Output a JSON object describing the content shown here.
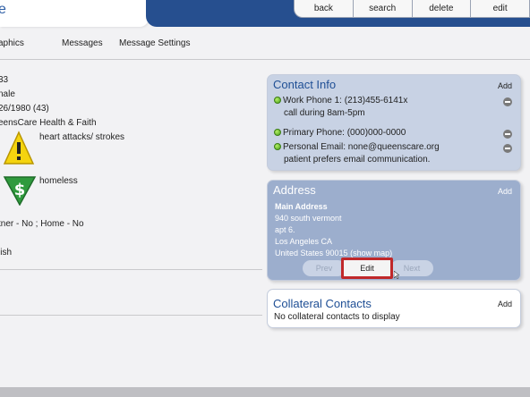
{
  "header": {
    "title_fragment": "e",
    "actions": [
      {
        "label": "back"
      },
      {
        "label": "search"
      },
      {
        "label": "delete"
      },
      {
        "label": "edit"
      }
    ]
  },
  "nav": {
    "tabs": [
      {
        "label": "aphics"
      },
      {
        "label": "Messages"
      },
      {
        "label": "Message Settings"
      }
    ]
  },
  "patient": {
    "id_fragment": "33",
    "gender_fragment": "nale",
    "dob_fragment": "26/1980 (43)",
    "affiliation_fragment": "eensCare Health & Faith",
    "flags": [
      {
        "icon": "warning-icon",
        "text": "heart attacks/ strokes"
      },
      {
        "icon": "dollar-icon",
        "text": "homeless"
      }
    ],
    "partner_line_fragment": "tner - No ;  Home - No",
    "language_fragment": "lish"
  },
  "contact_info": {
    "title": "Contact Info",
    "add_label": "Add",
    "items": [
      {
        "label": "Work Phone 1: (213)455-6141x",
        "note": "call during 8am-5pm"
      },
      {
        "label": "Primary Phone: (000)000-0000",
        "note": ""
      },
      {
        "label": "Personal Email: none@queenscare.org",
        "note": "patient prefers email communication."
      }
    ]
  },
  "address": {
    "title": "Address",
    "add_label": "Add",
    "name": "Main Address",
    "line1": "940 south vermont",
    "line2": "apt 6.",
    "city_state": "Los Angeles CA",
    "country_zip": "United States 90015",
    "map_link": "(show map)",
    "prev_label": "Prev",
    "edit_label": "Edit",
    "next_label": "Next"
  },
  "collateral": {
    "title": "Collateral Contacts",
    "add_label": "Add",
    "empty_text": "No collateral contacts to display"
  },
  "colors": {
    "header_blue": "#264f8f",
    "panel_light": "#c8d2e4",
    "panel_mid": "#9caecd",
    "highlight_red": "#c0282a",
    "status_green": "#46a11a"
  }
}
